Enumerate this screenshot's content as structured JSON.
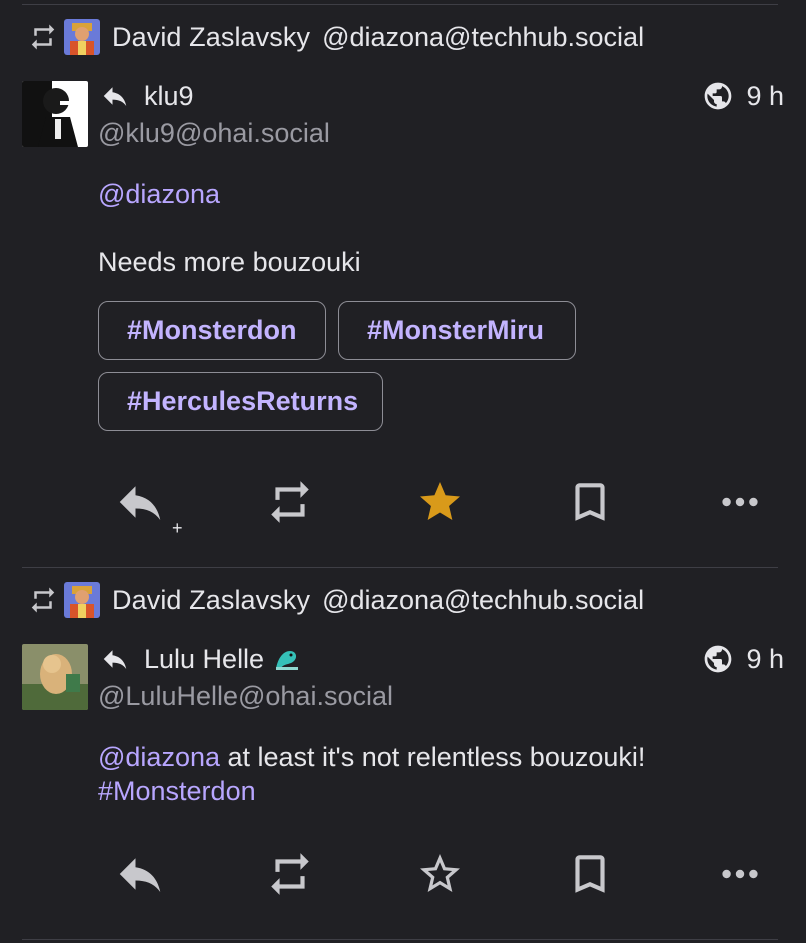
{
  "posts": [
    {
      "boosted_by": {
        "name": "David Zaslavsky",
        "handle": "@diazona@techhub.social"
      },
      "author": {
        "name": "klu9",
        "handle": "@klu9@ohai.social"
      },
      "time": "9 h",
      "content": {
        "mention": "@diazona",
        "paragraph": "Needs more bouzouki"
      },
      "tags": [
        "#Monsterdon",
        "#MonsterMiru",
        "#HerculesReturns"
      ],
      "favourited": true,
      "reply_plus": "+"
    },
    {
      "boosted_by": {
        "name": "David Zaslavsky",
        "handle": "@diazona@techhub.social"
      },
      "author": {
        "name": "Lulu Helle",
        "handle": "@LuluHelle@ohai.social"
      },
      "time": "9 h",
      "content": {
        "mention": "@diazona",
        "text": " at least it's not relentless bouzouki!",
        "hashtag": "#Monsterdon"
      },
      "favourited": false
    }
  ],
  "colors": {
    "accent": "#b8a6ff",
    "star": "#d99a1a",
    "background": "#202024"
  }
}
